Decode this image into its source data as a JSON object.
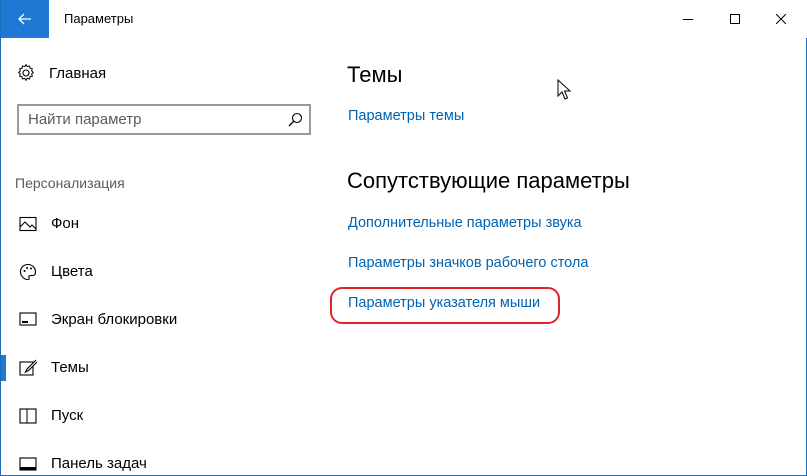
{
  "window": {
    "title": "Параметры",
    "accent": "#1e79d4",
    "link_color": "#0063b1",
    "highlight_color": "#e0242a"
  },
  "sidebar": {
    "home_label": "Главная",
    "search_placeholder": "Найти параметр",
    "section_label": "Персонализация",
    "items": [
      {
        "label": "Фон",
        "icon": "picture-icon"
      },
      {
        "label": "Цвета",
        "icon": "palette-icon"
      },
      {
        "label": "Экран блокировки",
        "icon": "lock-screen-icon"
      },
      {
        "label": "Темы",
        "icon": "brush-icon",
        "selected": true
      },
      {
        "label": "Пуск",
        "icon": "start-icon"
      },
      {
        "label": "Панель задач",
        "icon": "taskbar-icon"
      }
    ]
  },
  "main": {
    "section_title": "Темы",
    "theme_settings_link": "Параметры темы",
    "related_title": "Сопутствующие параметры",
    "related_links": [
      "Дополнительные параметры звука",
      "Параметры значков рабочего стола",
      "Параметры указателя мыши"
    ]
  }
}
